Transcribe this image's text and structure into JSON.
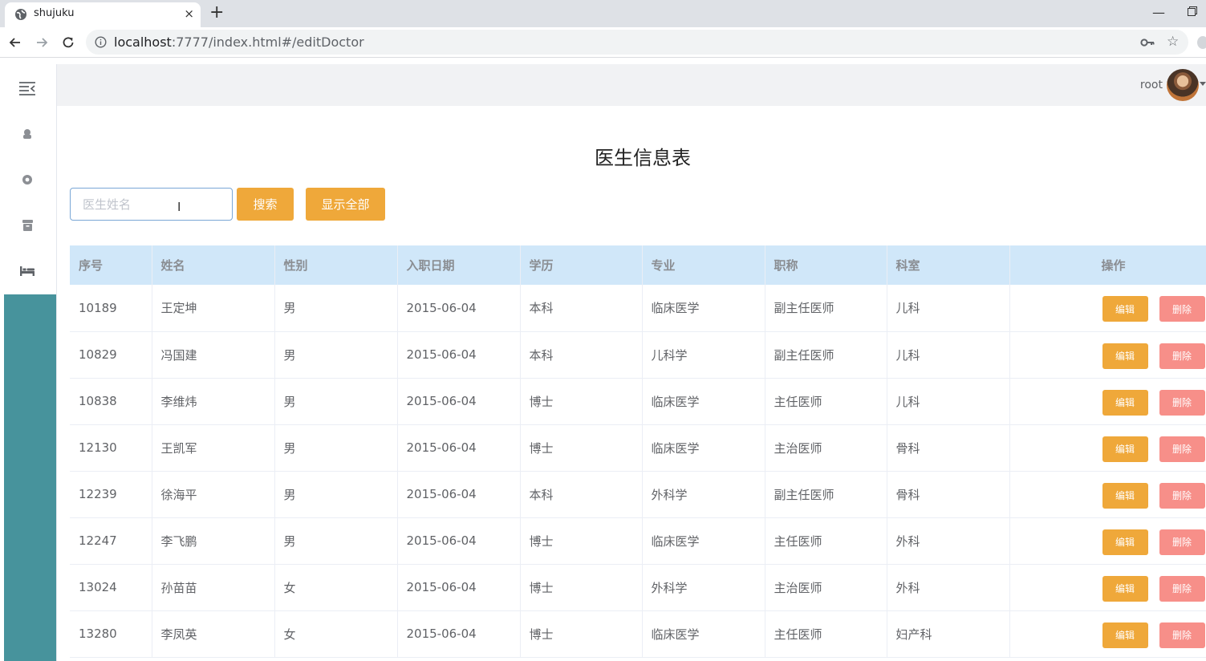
{
  "browser": {
    "tab_title": "shujuku",
    "tab_close": "×",
    "new_tab": "+",
    "url_host": "localhost",
    "url_rest": ":7777/index.html#/editDoctor",
    "min_glyph": "—"
  },
  "header": {
    "user": "root"
  },
  "page": {
    "title": "医生信息表"
  },
  "search": {
    "placeholder": "医生姓名",
    "value": "",
    "search_label": "搜索",
    "show_all_label": "显示全部"
  },
  "table": {
    "columns": [
      "序号",
      "姓名",
      "性别",
      "入职日期",
      "学历",
      "专业",
      "职称",
      "科室",
      "操作"
    ],
    "rows": [
      [
        "10189",
        "王定坤",
        "男",
        "2015-06-04",
        "本科",
        "临床医学",
        "副主任医师",
        "儿科"
      ],
      [
        "10829",
        "冯国建",
        "男",
        "2015-06-04",
        "本科",
        "儿科学",
        "副主任医师",
        "儿科"
      ],
      [
        "10838",
        "李维炜",
        "男",
        "2015-06-04",
        "博士",
        "临床医学",
        "主任医师",
        "儿科"
      ],
      [
        "12130",
        "王凯军",
        "男",
        "2015-06-04",
        "博士",
        "临床医学",
        "主治医师",
        "骨科"
      ],
      [
        "12239",
        "徐海平",
        "男",
        "2015-06-04",
        "本科",
        "外科学",
        "副主任医师",
        "骨科"
      ],
      [
        "12247",
        "李飞鹏",
        "男",
        "2015-06-04",
        "博士",
        "临床医学",
        "主任医师",
        "外科"
      ],
      [
        "13024",
        "孙苗苗",
        "女",
        "2015-06-04",
        "博士",
        "外科学",
        "主治医师",
        "外科"
      ],
      [
        "13280",
        "李凤英",
        "女",
        "2015-06-04",
        "博士",
        "临床医学",
        "主任医师",
        "妇产科"
      ]
    ],
    "edit_label": "编辑",
    "delete_label": "删除"
  },
  "colors": {
    "accent": "#efa83a",
    "danger": "#f78f89",
    "sidebar_active": "#47939c",
    "header_bg": "#d0e7f9"
  }
}
